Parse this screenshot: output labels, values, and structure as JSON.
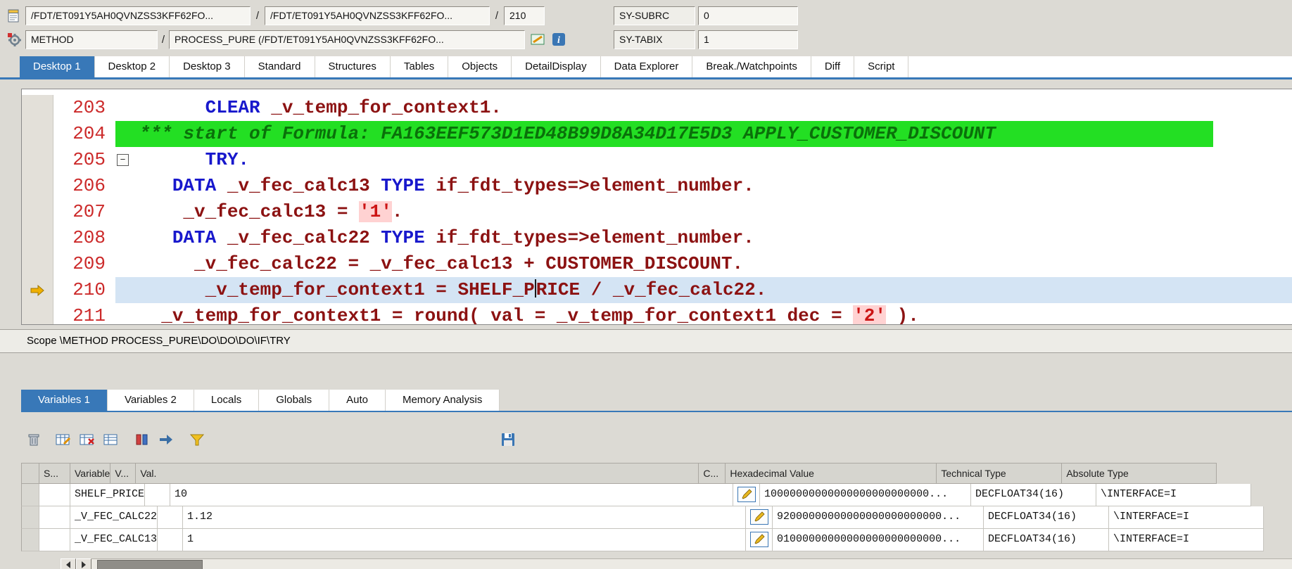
{
  "colors": {
    "active_tab": "#3878B8",
    "keyword": "#1818CC",
    "identifier": "#8C1212",
    "literal_bg": "#FFD2D2",
    "comment_bg": "#23DF23",
    "current_line_bg": "#D4E4F4",
    "line_number": "#CC2A2A"
  },
  "header": {
    "sep": "/",
    "header_icons": [
      "stack-icon",
      "method-icon",
      "display-change-icon",
      "info-icon"
    ],
    "row1": {
      "stack_field": "/FDT/ET091Y5AH0QVNZSS3KFF62FO...",
      "include_field": "/FDT/ET091Y5AH0QVNZSS3KFF62FO...",
      "line_number": "210",
      "sy_subrc_label": "SY-SUBRC",
      "sy_subrc_value": "0"
    },
    "row2": {
      "event_type": "METHOD",
      "event_detail": "PROCESS_PURE (/FDT/ET091Y5AH0QVNZSS3KFF62FO...",
      "sy_tabix_label": "SY-TABIX",
      "sy_tabix_value": "1"
    }
  },
  "desktop_tabs": {
    "items": [
      {
        "label": "Desktop 1",
        "active": true
      },
      {
        "label": "Desktop 2"
      },
      {
        "label": "Desktop 3"
      },
      {
        "label": "Standard"
      },
      {
        "label": "Structures"
      },
      {
        "label": "Tables"
      },
      {
        "label": "Objects"
      },
      {
        "label": "DetailDisplay"
      },
      {
        "label": "Data Explorer"
      },
      {
        "label": "Break./Watchpoints"
      },
      {
        "label": "Diff"
      },
      {
        "label": "Script"
      }
    ]
  },
  "editor": {
    "lines": [
      {
        "num": "203",
        "indent": 6,
        "segments": [
          {
            "s": "kw",
            "t": "CLEAR"
          },
          {
            "s": "id",
            "t": " _v_temp_for_context1."
          }
        ]
      },
      {
        "num": "204",
        "comment": true,
        "indent": 0,
        "segments": [
          {
            "s": "com",
            "t": "*** start of Formula: FA163EEF573D1ED48B99D8A34D17E5D3 APPLY_CUSTOMER_DISCOUNT"
          }
        ]
      },
      {
        "num": "205",
        "collapse": true,
        "indent": 6,
        "segments": [
          {
            "s": "kw",
            "t": "TRY."
          }
        ]
      },
      {
        "num": "206",
        "indent": 3,
        "segments": [
          {
            "s": "kw",
            "t": "DATA"
          },
          {
            "s": "id",
            "t": " _v_fec_calc13 "
          },
          {
            "s": "kw",
            "t": "TYPE"
          },
          {
            "s": "id",
            "t": " if_fdt_types=>element_number."
          }
        ]
      },
      {
        "num": "207",
        "indent": 4,
        "segments": [
          {
            "s": "id",
            "t": "_v_fec_calc13 = "
          },
          {
            "s": "lit",
            "t": "'1'"
          },
          {
            "s": "id",
            "t": "."
          }
        ]
      },
      {
        "num": "208",
        "indent": 3,
        "segments": [
          {
            "s": "kw",
            "t": "DATA"
          },
          {
            "s": "id",
            "t": " _v_fec_calc22 "
          },
          {
            "s": "kw",
            "t": "TYPE"
          },
          {
            "s": "id",
            "t": " if_fdt_types=>element_number."
          }
        ]
      },
      {
        "num": "209",
        "indent": 5,
        "segments": [
          {
            "s": "id",
            "t": "_v_fec_calc22 = _v_fec_calc13 + CUSTOMER_DISCOUNT."
          }
        ]
      },
      {
        "num": "210",
        "current": true,
        "indent": 6,
        "segments": [
          {
            "s": "id",
            "t": "_v_temp_for_context1 = SHELF_P"
          },
          {
            "s": "cursor",
            "t": ""
          },
          {
            "s": "id",
            "t": "RICE / _v_fec_calc22."
          }
        ]
      },
      {
        "num": "211",
        "indent": 2,
        "segments": [
          {
            "s": "id",
            "t": "_v_temp_for_context1 = round( val = _v_temp_for_context1 dec = "
          },
          {
            "s": "lit",
            "t": "'2'"
          },
          {
            "s": "id",
            "t": " )."
          }
        ]
      }
    ]
  },
  "scope_bar": {
    "text": "Scope \\METHOD PROCESS_PURE\\DO\\DO\\DO\\IF\\TRY"
  },
  "variables_tabs": {
    "items": [
      {
        "label": "Variables 1",
        "active": true
      },
      {
        "label": "Variables 2"
      },
      {
        "label": "Locals"
      },
      {
        "label": "Globals"
      },
      {
        "label": "Auto"
      },
      {
        "label": "Memory Analysis"
      }
    ]
  },
  "variables_toolbar": {
    "icons": [
      "delete",
      "edit-fields",
      "remove-fields",
      "field-list",
      "insert-column",
      "transfer",
      "filter",
      "save"
    ]
  },
  "variables_table": {
    "columns": [
      {
        "key": "sel",
        "label": ""
      },
      {
        "key": "s",
        "label": "S..."
      },
      {
        "key": "variable",
        "label": "Variable"
      },
      {
        "key": "v",
        "label": "V..."
      },
      {
        "key": "val",
        "label": "Val."
      },
      {
        "key": "c",
        "label": "C..."
      },
      {
        "key": "hex",
        "label": "Hexadecimal Value"
      },
      {
        "key": "tech",
        "label": "Technical Type"
      },
      {
        "key": "abs",
        "label": "Absolute Type"
      }
    ],
    "rows": [
      {
        "variable": "SHELF_PRICE",
        "val": "10",
        "hex": "10000000000000000000000000...",
        "tech": "DECFLOAT34(16)",
        "abs": "\\INTERFACE=I"
      },
      {
        "variable": "_V_FEC_CALC22",
        "val": "1.12",
        "hex": "92000000000000000000000000...",
        "tech": "DECFLOAT34(16)",
        "abs": "\\INTERFACE=I"
      },
      {
        "variable": "_V_FEC_CALC13",
        "val": "1",
        "hex": "01000000000000000000000000...",
        "tech": "DECFLOAT34(16)",
        "abs": "\\INTERFACE=I"
      }
    ]
  }
}
